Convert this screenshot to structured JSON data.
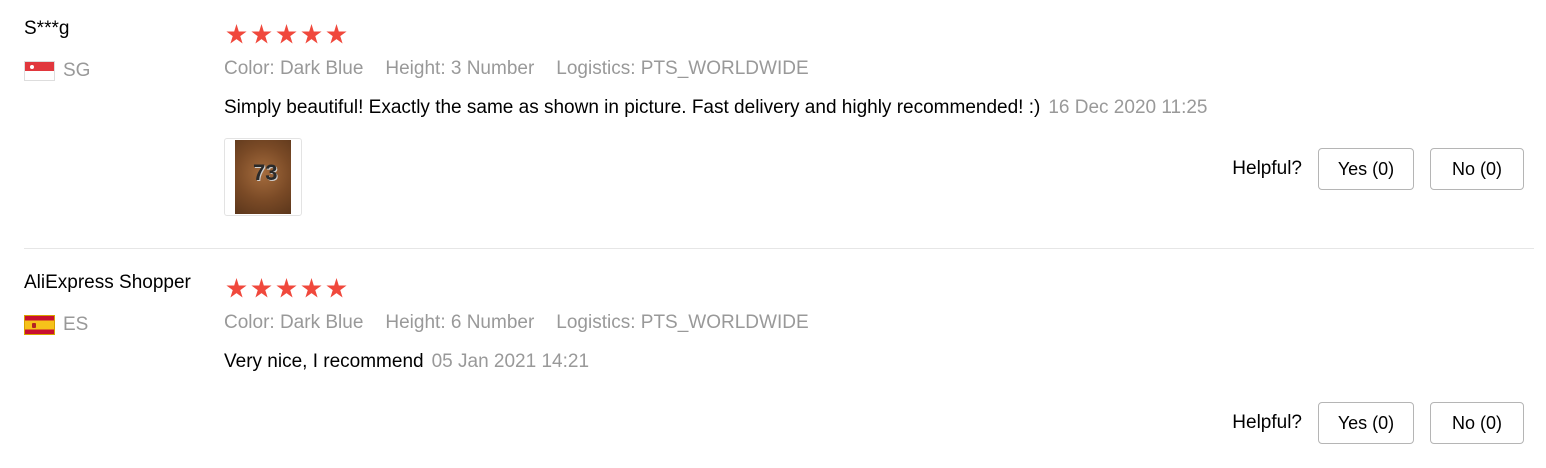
{
  "reviews": [
    {
      "user": "S***g",
      "country": "SG",
      "rating": 5,
      "attributes": {
        "color": "Color: Dark Blue",
        "height": "Height: 3 Number",
        "logistics": "Logistics: PTS_WORLDWIDE"
      },
      "text": "Simply beautiful! Exactly the same as shown in picture. Fast delivery and highly recommended! :)",
      "date": "16 Dec 2020 11:25",
      "helpful": {
        "label": "Helpful?",
        "yes": "Yes (0)",
        "no": "No (0)"
      }
    },
    {
      "user": "AliExpress Shopper",
      "country": "ES",
      "rating": 5,
      "attributes": {
        "color": "Color: Dark Blue",
        "height": "Height: 6 Number",
        "logistics": "Logistics: PTS_WORLDWIDE"
      },
      "text": "Very nice, I recommend",
      "date": "05 Jan 2021 14:21",
      "helpful": {
        "label": "Helpful?",
        "yes": "Yes (0)",
        "no": "No (0)"
      }
    }
  ],
  "colors": {
    "star": "#f0483c",
    "muted": "#999999",
    "divider": "#e6e6e6"
  },
  "icons": {
    "star": "star-icon",
    "flag_sg": "singapore-flag-icon",
    "flag_es": "spain-flag-icon"
  }
}
